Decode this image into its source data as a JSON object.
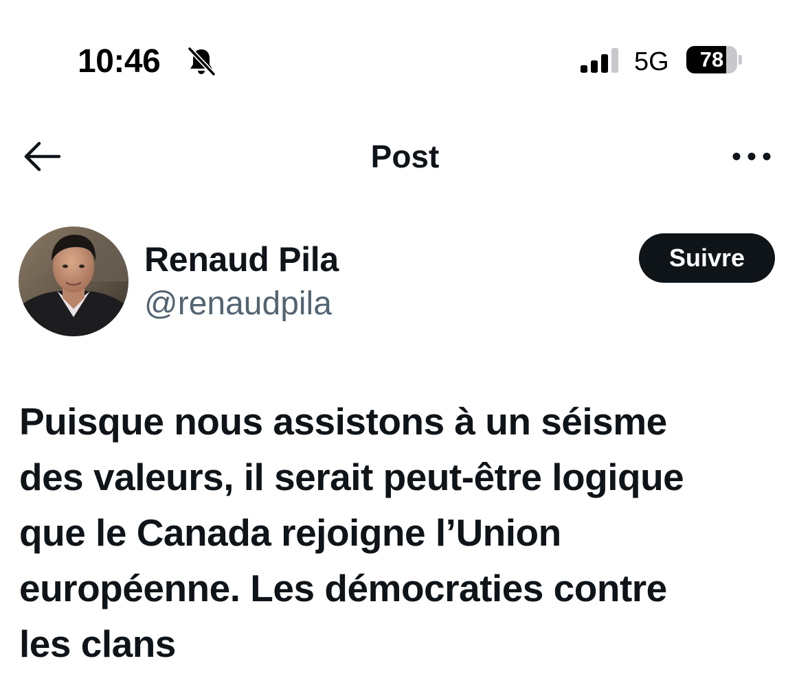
{
  "status_bar": {
    "time": "10:46",
    "silent_icon": "bell-slash-icon",
    "signal_icon": "cellular-signal-icon",
    "network": "5G",
    "battery_percent": 78,
    "battery_label": "78"
  },
  "header": {
    "title": "Post",
    "back_icon": "arrow-left-icon",
    "more_icon": "more-horizontal-icon"
  },
  "author": {
    "name": "Renaud Pila",
    "handle": "@renaudpila",
    "follow_label": "Suivre"
  },
  "post": {
    "lines": [
      "Puisque nous assistons à un séisme",
      "des valeurs, il serait peut-être logique",
      "que le Canada rejoigne l’Union",
      "européenne. Les démocraties contre",
      "les clans"
    ]
  },
  "colors": {
    "text_primary": "#0f1419",
    "text_secondary": "#536471",
    "button_background": "#0f1419",
    "button_text": "#ffffff",
    "background": "#ffffff"
  }
}
